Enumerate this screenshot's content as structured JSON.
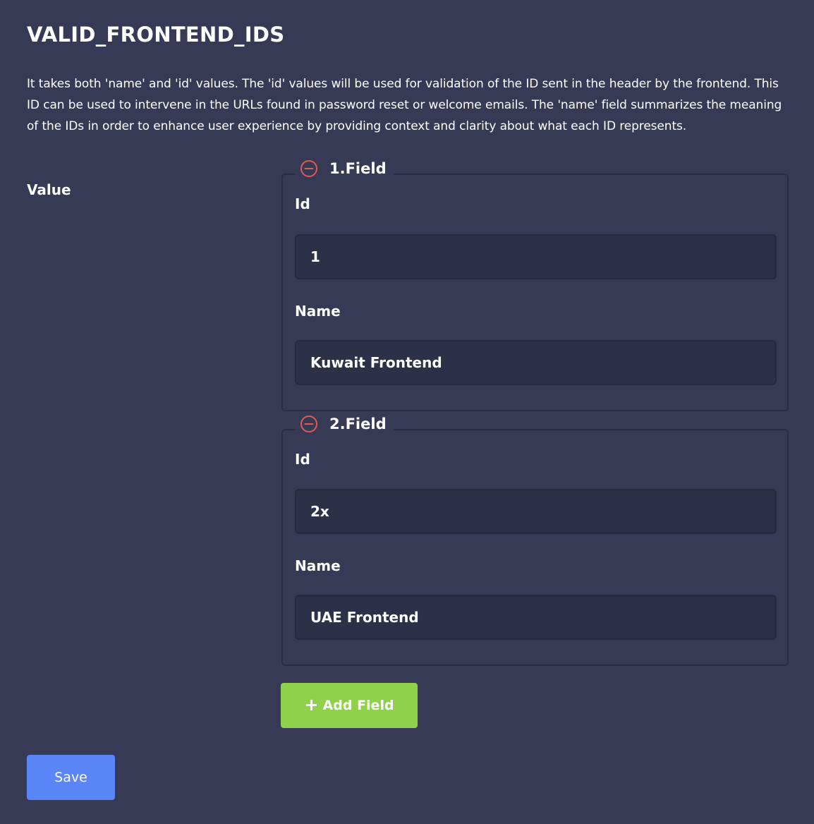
{
  "setting": {
    "title": "VALID_FRONTEND_IDS",
    "description": "It takes both 'name' and 'id' values. The 'id' values will be used for validation of the ID sent in the header by the frontend. This ID can be used to intervene in the URLs found in password reset or welcome emails. The 'name' field summarizes the meaning of the IDs in order to enhance user experience by providing context and clarity about what each ID represents.",
    "value_label": "Value"
  },
  "fields": [
    {
      "legend": "1.Field",
      "id_label": "Id",
      "id_value": "1",
      "name_label": "Name",
      "name_value": "Kuwait Frontend"
    },
    {
      "legend": "2.Field",
      "id_label": "Id",
      "id_value": "2x",
      "name_label": "Name",
      "name_value": "UAE Frontend"
    }
  ],
  "actions": {
    "add_field_label": "Add Field",
    "add_icon": "plus-icon",
    "remove_icon": "minus-circle-icon",
    "save_label": "Save"
  },
  "colors": {
    "background": "#363a55",
    "input_background": "#2d3148",
    "remove_icon": "#e05a5a",
    "add_button": "#8fd14a",
    "save_button": "#5b86f7"
  }
}
